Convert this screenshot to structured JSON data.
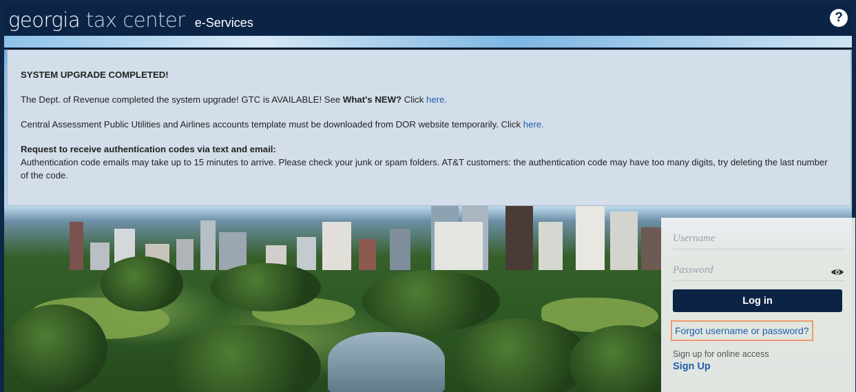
{
  "header": {
    "logo_part1": "georgia",
    "logo_part2": "tax center",
    "subtitle": "e-Services",
    "help_icon": "question-circle-icon"
  },
  "notice": {
    "title": "SYSTEM UPGRADE COMPLETED!",
    "p1_text": "The Dept. of Revenue completed the system upgrade!   GTC is AVAILABLE! See ",
    "p1_bold": "What's NEW?",
    "p1_click": " Click ",
    "p1_link": "here.",
    "p2_text": "Central Assessment Public Utilities and Airlines accounts template must be downloaded from DOR website temporarily. Click ",
    "p2_link": "here.",
    "auth_heading": "Request to receive authentication codes via text and email:",
    "auth_body": "Authentication code emails may take up to 15 minutes to arrive. Please check your junk or spam folders. AT&T customers: the authentication code may have too many digits, try deleting the last number of the code."
  },
  "login": {
    "username_placeholder": "Username",
    "password_placeholder": "Password",
    "eye_icon": "eye-icon",
    "login_label": "Log in",
    "forgot_label": "Forgot username or password?",
    "signup_prompt": "Sign up for online access",
    "signup_label": "Sign Up"
  },
  "colors": {
    "navy": "#0b2446",
    "link": "#1f5faa",
    "notice_bg": "#d3deea",
    "highlight": "#ee9a6a"
  }
}
